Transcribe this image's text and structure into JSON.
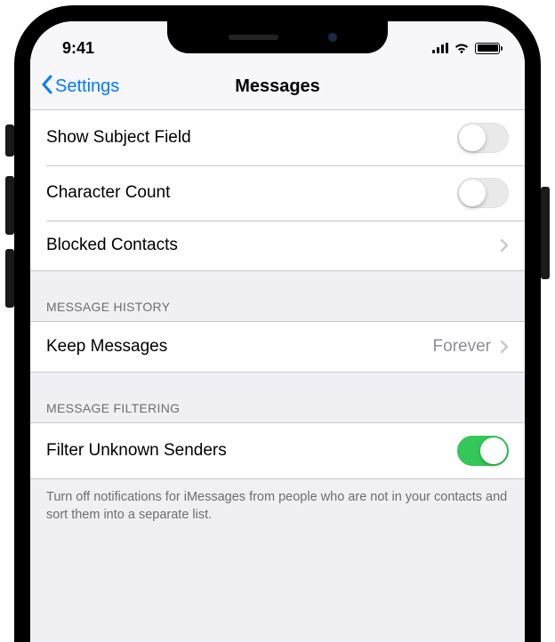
{
  "statusbar": {
    "time": "9:41"
  },
  "navbar": {
    "back_label": "Settings",
    "title": "Messages"
  },
  "first_group": {
    "items": [
      {
        "label": "Show Subject Field",
        "type": "switch",
        "on": false
      },
      {
        "label": "Character Count",
        "type": "switch",
        "on": false
      },
      {
        "label": "Blocked Contacts",
        "type": "nav"
      }
    ]
  },
  "history_group": {
    "header": "MESSAGE HISTORY",
    "items": [
      {
        "label": "Keep Messages",
        "type": "nav",
        "value": "Forever"
      }
    ]
  },
  "filtering_group": {
    "header": "MESSAGE FILTERING",
    "items": [
      {
        "label": "Filter Unknown Senders",
        "type": "switch",
        "on": true
      }
    ],
    "footer": "Turn off notifications for iMessages from people who are not in your contacts and sort them into a separate list."
  },
  "colors": {
    "accent": "#007aff",
    "switch_on": "#34c759"
  }
}
